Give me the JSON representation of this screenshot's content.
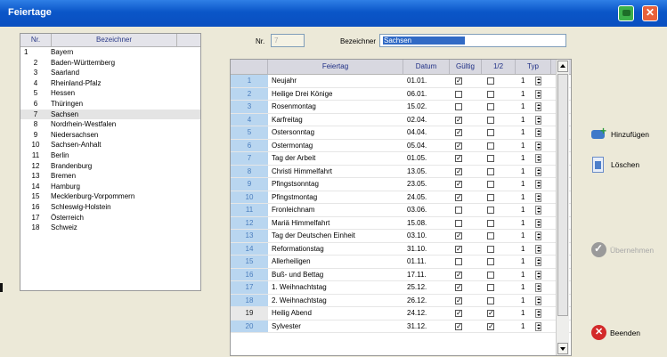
{
  "window": {
    "title": "Feiertage"
  },
  "states": {
    "columns": [
      "Nr.",
      "Bezeichner"
    ],
    "selected_index": 6,
    "items": [
      {
        "nr": "1",
        "name": "Bayern"
      },
      {
        "nr": "2",
        "name": "Baden-Württemberg"
      },
      {
        "nr": "3",
        "name": "Saarland"
      },
      {
        "nr": "4",
        "name": "Rheinland-Pfalz"
      },
      {
        "nr": "5",
        "name": "Hessen"
      },
      {
        "nr": "6",
        "name": "Thüringen"
      },
      {
        "nr": "7",
        "name": "Sachsen"
      },
      {
        "nr": "8",
        "name": "Nordrhein-Westfalen"
      },
      {
        "nr": "9",
        "name": "Niedersachsen"
      },
      {
        "nr": "10",
        "name": "Sachsen-Anhalt"
      },
      {
        "nr": "11",
        "name": "Berlin"
      },
      {
        "nr": "12",
        "name": "Brandenburg"
      },
      {
        "nr": "13",
        "name": "Bremen"
      },
      {
        "nr": "14",
        "name": "Hamburg"
      },
      {
        "nr": "15",
        "name": "Mecklenburg-Vorpommern"
      },
      {
        "nr": "16",
        "name": "Schleswig-Holstein"
      },
      {
        "nr": "17",
        "name": "Österreich"
      },
      {
        "nr": "18",
        "name": "Schweiz"
      }
    ]
  },
  "form": {
    "nr_label": "Nr.",
    "nr_value": "7",
    "bezeichner_label": "Bezeichner",
    "bezeichner_value": "Sachsen"
  },
  "holidays": {
    "columns": [
      "",
      "Feiertag",
      "Datum",
      "Gültig",
      "1/2",
      "Typ"
    ],
    "rows": [
      {
        "n": "1",
        "name": "Neujahr",
        "date": "01.01.",
        "valid": true,
        "half": false,
        "typ": "1"
      },
      {
        "n": "2",
        "name": "Heilige Drei Könige",
        "date": "06.01.",
        "valid": false,
        "half": false,
        "typ": "1"
      },
      {
        "n": "3",
        "name": "Rosenmontag",
        "date": "15.02.",
        "valid": false,
        "half": false,
        "typ": "1"
      },
      {
        "n": "4",
        "name": "Karfreitag",
        "date": "02.04.",
        "valid": true,
        "half": false,
        "typ": "1"
      },
      {
        "n": "5",
        "name": "Ostersonntag",
        "date": "04.04.",
        "valid": true,
        "half": false,
        "typ": "1"
      },
      {
        "n": "6",
        "name": "Ostermontag",
        "date": "05.04.",
        "valid": true,
        "half": false,
        "typ": "1"
      },
      {
        "n": "7",
        "name": "Tag der Arbeit",
        "date": "01.05.",
        "valid": true,
        "half": false,
        "typ": "1"
      },
      {
        "n": "8",
        "name": "Christi Himmelfahrt",
        "date": "13.05.",
        "valid": true,
        "half": false,
        "typ": "1"
      },
      {
        "n": "9",
        "name": "Pfingstsonntag",
        "date": "23.05.",
        "valid": true,
        "half": false,
        "typ": "1"
      },
      {
        "n": "10",
        "name": "Pfingstmontag",
        "date": "24.05.",
        "valid": true,
        "half": false,
        "typ": "1"
      },
      {
        "n": "11",
        "name": "Fronleichnam",
        "date": "03.06.",
        "valid": false,
        "half": false,
        "typ": "1"
      },
      {
        "n": "12",
        "name": "Mariä Himmelfahrt",
        "date": "15.08.",
        "valid": false,
        "half": false,
        "typ": "1"
      },
      {
        "n": "13",
        "name": "Tag der Deutschen Einheit",
        "date": "03.10.",
        "valid": true,
        "half": false,
        "typ": "1"
      },
      {
        "n": "14",
        "name": "Reformationstag",
        "date": "31.10.",
        "valid": true,
        "half": false,
        "typ": "1"
      },
      {
        "n": "15",
        "name": "Allerheiligen",
        "date": "01.11.",
        "valid": false,
        "half": false,
        "typ": "1"
      },
      {
        "n": "16",
        "name": "Buß- und Bettag",
        "date": "17.11.",
        "valid": true,
        "half": false,
        "typ": "1"
      },
      {
        "n": "17",
        "name": "1. Weihnachtstag",
        "date": "25.12.",
        "valid": true,
        "half": false,
        "typ": "1"
      },
      {
        "n": "18",
        "name": "2. Weihnachtstag",
        "date": "26.12.",
        "valid": true,
        "half": false,
        "typ": "1"
      },
      {
        "n": "19",
        "name": "Heilig Abend",
        "date": "24.12.",
        "valid": true,
        "half": true,
        "typ": "1",
        "selected": true
      },
      {
        "n": "20",
        "name": "Sylvester",
        "date": "31.12.",
        "valid": true,
        "half": true,
        "typ": "1"
      }
    ]
  },
  "actions": {
    "add": "Hinzufügen",
    "delete": "Löschen",
    "apply": "Übernehmen",
    "exit": "Beenden"
  },
  "colors": {
    "titlebar": "#0a56c8",
    "row_number_bg": "#b9d6f0"
  }
}
